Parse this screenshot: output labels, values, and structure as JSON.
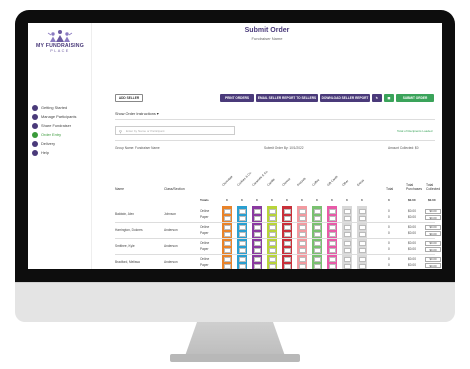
{
  "app": {
    "logo_line1": "MY FUNDRAISING",
    "logo_line2": "PLACE",
    "brand_color": "#4a3a7a",
    "accent_color": "#3aa35a"
  },
  "sidebar": {
    "items": [
      {
        "label": "Getting Started",
        "icon": "rocket-icon"
      },
      {
        "label": "Manage Participants",
        "icon": "users-icon"
      },
      {
        "label": "Share Fundraiser",
        "icon": "share-icon"
      },
      {
        "label": "Order Entry",
        "icon": "document-icon",
        "active": true
      },
      {
        "label": "Delivery",
        "icon": "truck-icon"
      },
      {
        "label": "Help",
        "icon": "help-icon"
      }
    ]
  },
  "header": {
    "title": "Submit Order",
    "subtitle": "Fundraiser Name"
  },
  "toolbar": {
    "add_seller": "ADD SELLER",
    "print_orders": "PRINT ORDERS",
    "email_seller": "EMAIL SELLER REPORT TO SELLERS",
    "download_seller": "DOWNLOAD SELLER REPORT",
    "submit_order": "SUBMIT ORDER"
  },
  "instructions_label": "Show Order Instructions",
  "search": {
    "placeholder": "Enter by Name or Participant"
  },
  "note_right": "Total of Recipients Loaded",
  "meta": {
    "group_name": "Group Name: Fundraiser Name",
    "submitted_by": "Submit Order By: 10/1/2022",
    "amount_collected": "Amount Collected: $0"
  },
  "table": {
    "headers": {
      "name": "Name",
      "class": "Class/Section",
      "total": "Total",
      "total_purchases": "Total Purchases",
      "total_collected": "Total Collected"
    },
    "product_columns": [
      {
        "label": "Chocolate",
        "color": "#e8832a"
      },
      {
        "label": "Cookies & Co.",
        "color": "#2a9fd0"
      },
      {
        "label": "Caramels & Co.",
        "color": "#8a3aa0"
      },
      {
        "label": "Candle",
        "color": "#b8d43a"
      },
      {
        "label": "Cheese",
        "color": "#c8303a"
      },
      {
        "label": "Pretzels",
        "color": "#f29aa0"
      },
      {
        "label": "Coffee",
        "color": "#7ac070"
      },
      {
        "label": "Gift Cards",
        "color": "#e85aa8"
      },
      {
        "label": "Other",
        "color": "#d8d8d8"
      },
      {
        "label": "Extras",
        "color": "#d8d8d8"
      }
    ],
    "totals_label": "Totals",
    "totals": [
      "0",
      "0",
      "0",
      "0",
      "0",
      "0",
      "0",
      "0",
      "0",
      "0"
    ],
    "totals_total": "0",
    "totals_purchases": "$0.00",
    "totals_collected": "$0.00",
    "rows": [
      {
        "name": "Baldwin, Alex",
        "class": "Johnson",
        "online": "Online",
        "paper": "Paper",
        "total_online": "0",
        "total_paper": "0",
        "purchase_online": "$0.00",
        "purchase_paper": "$0.00",
        "collected_online": "$0.00",
        "collected_paper": "$0.00"
      },
      {
        "name": "Harrington, Dolores",
        "class": "Anderson",
        "online": "Online",
        "paper": "Paper",
        "total_online": "0",
        "total_paper": "0",
        "purchase_online": "$0.00",
        "purchase_paper": "$0.00",
        "collected_online": "$0.00",
        "collected_paper": "$0.00"
      },
      {
        "name": "Smithee, Kyle",
        "class": "Anderson",
        "online": "Online",
        "paper": "Paper",
        "total_online": "0",
        "total_paper": "0",
        "purchase_online": "$0.00",
        "purchase_paper": "$0.00",
        "collected_online": "$0.00",
        "collected_paper": "$0.00"
      },
      {
        "name": "Bradford, Melissa",
        "class": "Anderson",
        "online": "Online",
        "paper": "Paper",
        "total_online": "0",
        "total_paper": "0",
        "purchase_online": "$0.00",
        "purchase_paper": "$0.00",
        "collected_online": "$0.00",
        "collected_paper": "$0.00"
      }
    ]
  }
}
